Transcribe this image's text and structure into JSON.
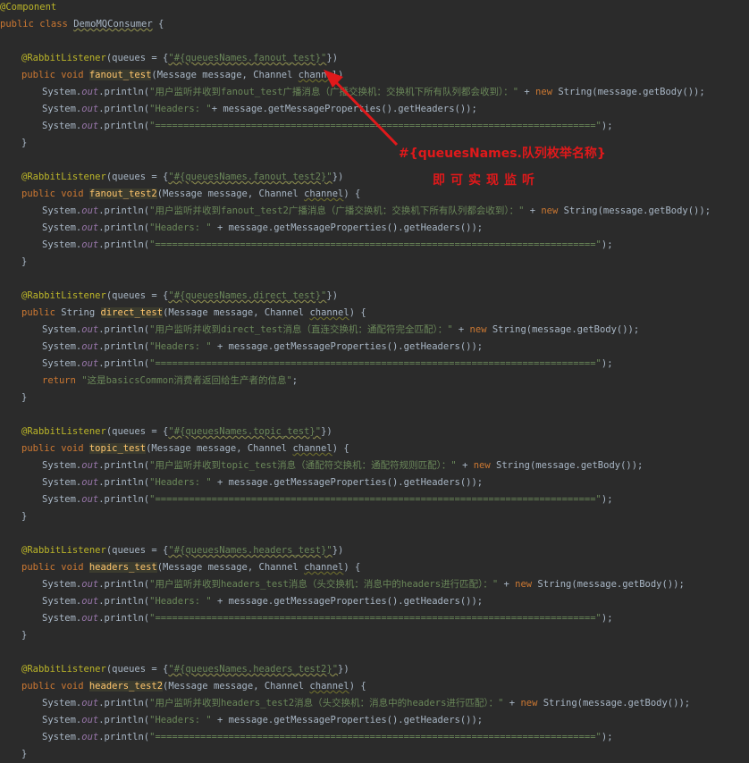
{
  "code": {
    "l0": {
      "annotation": "@Component"
    },
    "l1": {
      "kw": "public class ",
      "classname": "DemoMQConsumer",
      "brace": " {"
    },
    "m1": {
      "ann": "@RabbitListener",
      "open": "(queues = {",
      "str": "\"#{queuesNames.fanout_test}\"",
      "close": "})",
      "sig_kw": "public void ",
      "name": "fanout_test",
      "params": "(Message message, Channel ",
      "param": "channel",
      "sig_end": ")",
      "p1_obj": "System.",
      "p1_fld": "out",
      "p1_call": ".println(",
      "p1_str": "\"用户监听并收到fanout_test广播消息（广播交换机：交换机下所有队列都会收到）：\"",
      "p1_plus": " + ",
      "p1_new": "new ",
      "p1_tail": "String(message.getBody());",
      "p2_obj": "System.",
      "p2_fld": "out",
      "p2_call": ".println(",
      "p2_str": "\"Headers: \"",
      "p2_tail": "+ message.getMessageProperties().getHeaders());",
      "p3_obj": "System.",
      "p3_fld": "out",
      "p3_call": ".println(",
      "p3_str": "\"==============================================================================\"",
      "p3_tail": ");",
      "end": "}"
    },
    "m2": {
      "ann": "@RabbitListener",
      "open": "(queues = {",
      "str": "\"#{queuesNames.fanout_test2}\"",
      "close": "})",
      "sig_kw": "public void ",
      "name": "fanout_test2",
      "params": "(Message message, Channel ",
      "param": "channel",
      "sig_end": ") {",
      "p1_str": "\"用户监听并收到fanout_test2广播消息（广播交换机：交换机下所有队列都会收到）：\"",
      "p1_tail": "String(message.getBody());",
      "p2_str": "\"Headers: \"",
      "p2_tail": " + message.getMessageProperties().getHeaders());",
      "p3_str": "\"==============================================================================\"",
      "p3_tail": ");",
      "end": "}"
    },
    "m3": {
      "ann": "@RabbitListener",
      "open": "(queues = {",
      "str": "\"#{queuesNames.direct_test}\"",
      "close": "})",
      "sig_kw": "public ",
      "ret": "String ",
      "name": "direct_test",
      "params": "(Message message, Channel ",
      "param": "channel",
      "sig_end": ") {",
      "p1_str": "\"用户监听并收到direct_test消息（直连交换机：通配符完全匹配）：\"",
      "p1_tail": "String(message.getBody());",
      "p2_str": "\"Headers: \"",
      "p2_tail": " + message.getMessageProperties().getHeaders());",
      "p3_str": "\"==============================================================================\"",
      "p3_tail": ");",
      "ret_kw": "return ",
      "ret_str": "\"这是basicsCommon消费者返回给生产者的信息\"",
      "ret_end": ";",
      "end": "}"
    },
    "m4": {
      "ann": "@RabbitListener",
      "open": "(queues = {",
      "str": "\"#{queuesNames.topic_test}\"",
      "close": "})",
      "sig_kw": "public void ",
      "name": "topic_test",
      "params": "(Message message, Channel ",
      "param": "channel",
      "sig_end": ") {",
      "p1_str": "\"用户监听并收到topic_test消息（通配符交换机：通配符规则匹配）：\"",
      "p1_tail": "String(message.getBody());",
      "p2_str": "\"Headers: \"",
      "p2_tail": " + message.getMessageProperties().getHeaders());",
      "p3_str": "\"==============================================================================\"",
      "p3_tail": ");",
      "end": "}"
    },
    "m5": {
      "ann": "@RabbitListener",
      "open": "(queues = {",
      "str": "\"#{queuesNames.headers_test}\"",
      "close": "})",
      "sig_kw": "public void ",
      "name": "headers_test",
      "params": "(Message message, Channel ",
      "param": "channel",
      "sig_end": ") {",
      "p1_str": "\"用户监听并收到headers_test消息（头交换机：消息中的headers进行匹配）：\"",
      "p1_tail": "String(message.getBody());",
      "p2_str": "\"Headers: \"",
      "p2_tail": " + message.getMessageProperties().getHeaders());",
      "p3_str": "\"==============================================================================\"",
      "p3_tail": ");",
      "end": "}"
    },
    "m6": {
      "ann": "@RabbitListener",
      "open": "(queues = {",
      "str": "\"#{queuesNames.headers_test2}\"",
      "close": "})",
      "sig_kw": "public void ",
      "name": "headers_test2",
      "params": "(Message message, Channel ",
      "param": "channel",
      "sig_end": ") {",
      "p1_str": "\"用户监听并收到headers_test2消息（头交换机：消息中的headers进行匹配）：\"",
      "p1_tail": "String(message.getBody());",
      "p2_str": "\"Headers: \"",
      "p2_tail": " + message.getMessageProperties().getHeaders());",
      "p3_str": "\"==============================================================================\"",
      "p3_tail": ");",
      "end": "}"
    },
    "common": {
      "obj": "System.",
      "fld": "out",
      "call": ".println(",
      "plus": " + ",
      "new_kw": "new "
    }
  },
  "callout": {
    "line1": "#{queuesNames.队列枚举名称}",
    "line2": "即可实现监听"
  },
  "colors": {
    "background": "#2b2b2b",
    "annotation": "#bbb529",
    "keyword": "#cc7832",
    "string": "#6a8759",
    "field": "#9876aa",
    "method": "#ffc66d",
    "text": "#a9b7c6",
    "callout": "#e0191b"
  }
}
